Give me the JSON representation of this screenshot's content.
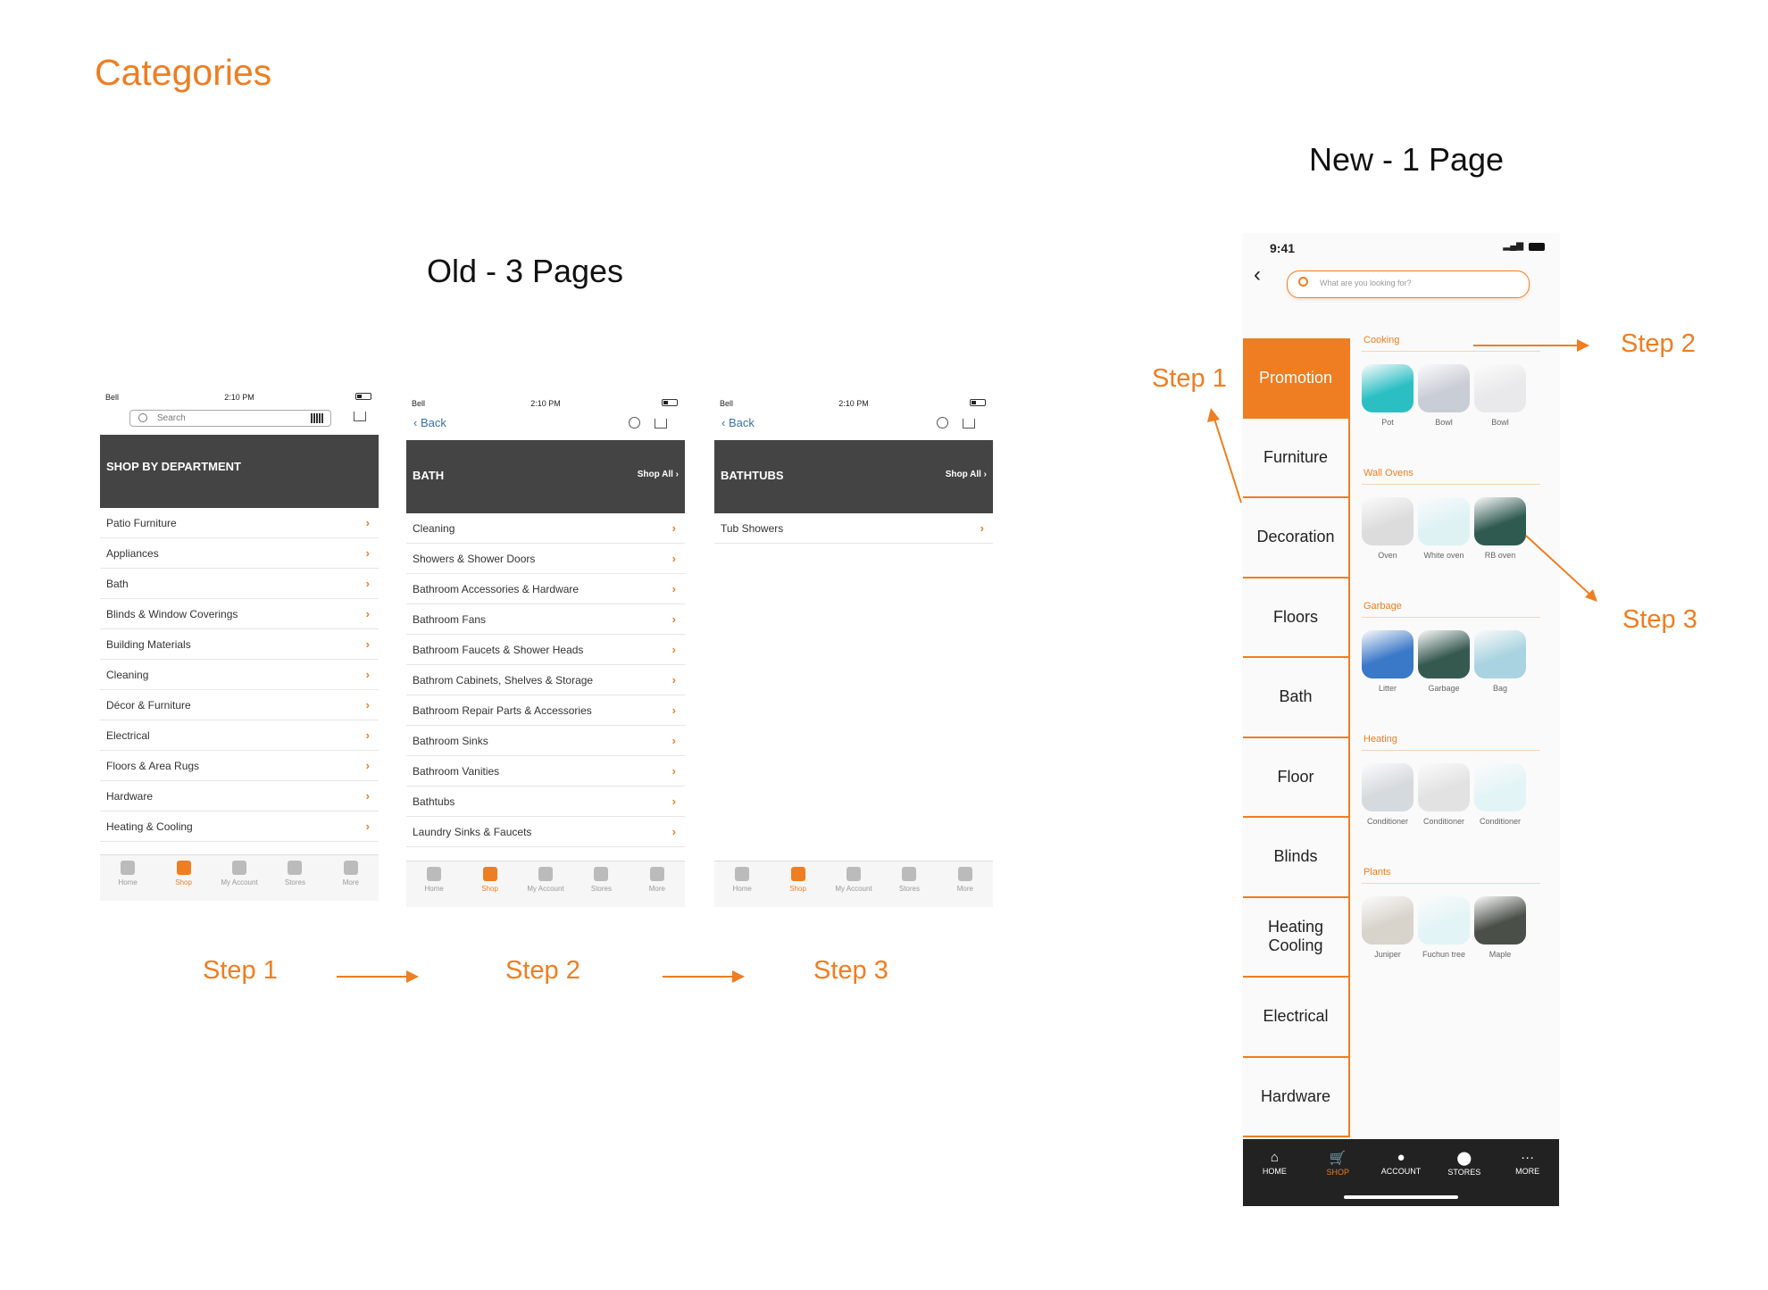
{
  "title": "Categories",
  "old": {
    "heading": "Old - 3 Pages",
    "phones": [
      {
        "header": "SHOP BY DEPARTMENT",
        "carrier": "Bell",
        "time": "2:10 PM",
        "search_placeholder": "Search",
        "items": [
          "Patio Furniture",
          "Appliances",
          "Bath",
          "Blinds & Window Coverings",
          "Building Materials",
          "Cleaning",
          "Décor & Furniture",
          "Electrical",
          "Floors & Area Rugs",
          "Hardware",
          "Heating & Cooling"
        ]
      },
      {
        "header": "BATH",
        "shop_all": "Shop All",
        "back": "Back",
        "carrier": "Bell",
        "time": "2:10 PM",
        "items": [
          "Cleaning",
          "Showers & Shower Doors",
          "Bathroom Accessories & Hardware",
          "Bathroom Fans",
          "Bathroom Faucets & Shower Heads",
          "Bathrom Cabinets, Shelves & Storage",
          "Bathroom Repair Parts & Accessories",
          "Bathroom Sinks",
          "Bathroom Vanities",
          "Bathtubs",
          "Laundry Sinks & Faucets"
        ]
      },
      {
        "header": "BATHTUBS",
        "shop_all": "Shop All",
        "back": "Back",
        "carrier": "Bell",
        "time": "2:10 PM",
        "items": [
          "Tub Showers"
        ]
      }
    ],
    "tabs": [
      "Home",
      "Shop",
      "My Account",
      "Stores",
      "More"
    ],
    "active_tab": "Shop",
    "steps": [
      "Step 1",
      "Step 2",
      "Step 3"
    ]
  },
  "new": {
    "heading": "New - 1 Page",
    "time": "9:41",
    "search_placeholder": "What are you looking for?",
    "sidebar": [
      "Promotion",
      "Furniture",
      "Decoration",
      "Floors",
      "Bath",
      "Floor",
      "Blinds",
      "Heating Cooling",
      "Electrical",
      "Hardware"
    ],
    "active_sidebar": "Promotion",
    "sections": [
      {
        "title": "Cooking",
        "items": [
          {
            "label": "Pot",
            "color": "#2bbfc4"
          },
          {
            "label": "Bowl",
            "color": "#c9cdd6"
          },
          {
            "label": "Bowl",
            "color": "#e9e9eb"
          }
        ]
      },
      {
        "title": "Wall Ovens",
        "items": [
          {
            "label": "Oven",
            "color": "#dcdcdc"
          },
          {
            "label": "White oven",
            "color": "#def2f4"
          },
          {
            "label": "RB oven",
            "color": "#2f5a50"
          }
        ]
      },
      {
        "title": "Garbage",
        "items": [
          {
            "label": "Litter",
            "color": "#3a78c8"
          },
          {
            "label": "Garbage",
            "color": "#35594f"
          },
          {
            "label": "Bag",
            "color": "#a9d3e0"
          }
        ]
      },
      {
        "title": "Heating",
        "items": [
          {
            "label": "Conditioner",
            "color": "#d5dade"
          },
          {
            "label": "Conditioner",
            "color": "#e2e2e2"
          },
          {
            "label": "Conditioner",
            "color": "#e3f4f6"
          }
        ]
      },
      {
        "title": "Plants",
        "items": [
          {
            "label": "Juniper",
            "color": "#d8d3cb"
          },
          {
            "label": "Fuchun tree",
            "color": "#e3f4f6"
          },
          {
            "label": "Maple",
            "color": "#4a5048"
          }
        ]
      }
    ],
    "nav": [
      {
        "label": "HOME",
        "icon": "home-icon",
        "glyph": "⌂"
      },
      {
        "label": "SHOP",
        "icon": "cart-icon",
        "glyph": "🛒"
      },
      {
        "label": "ACCOUNT",
        "icon": "user-icon",
        "glyph": "●"
      },
      {
        "label": "STORES",
        "icon": "location-pin-icon",
        "glyph": "⬤"
      },
      {
        "label": "MORE",
        "icon": "more-icon",
        "glyph": "···"
      }
    ],
    "active_nav": "SHOP",
    "steps": [
      "Step 1",
      "Step 2",
      "Step 3"
    ]
  },
  "colors": {
    "accent": "#ef7d22",
    "dark_header": "#444444",
    "nav_bg": "#222222"
  }
}
